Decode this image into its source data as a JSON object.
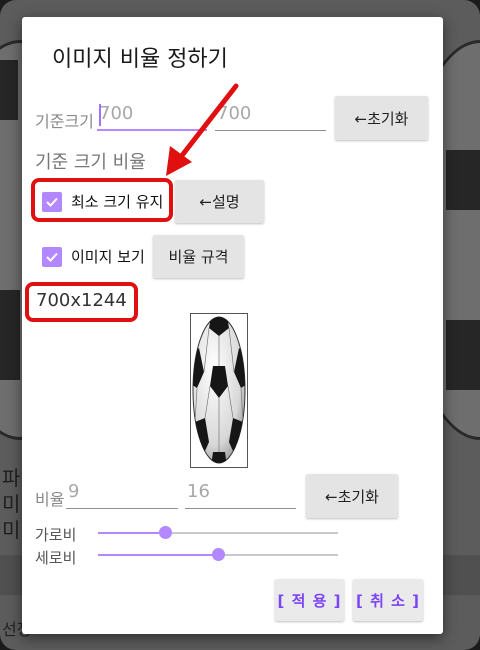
{
  "background": {
    "side_text_lines": [
      "파일",
      "미",
      "미"
    ],
    "bottom_text": "선정"
  },
  "dialog": {
    "title": "이미지 비율 정하기",
    "base_size": {
      "label": "기준크기",
      "width_value": "700",
      "height_value": "700",
      "reset_label": "←초기화"
    },
    "ratio_section_label": "기준 크기 비율",
    "keep_min_size": {
      "label": "최소 크기 유지",
      "checked": true,
      "help_label": "←설명"
    },
    "show_image": {
      "label": "이미지 보기",
      "checked": true,
      "standard_label": "비율 규격"
    },
    "result_size": "700x1244",
    "ratio": {
      "label": "비율",
      "width_value": "9",
      "height_value": "16",
      "reset_label": "←초기화"
    },
    "sliders": [
      {
        "label": "가로비",
        "value": 0.28
      },
      {
        "label": "세로비",
        "value": 0.5
      }
    ],
    "apply_label": "[ 적 용 ]",
    "cancel_label": "[ 취 소 ]"
  },
  "colors": {
    "accent": "#b388ff",
    "action_text": "#7b45f5",
    "highlight": "#e01010"
  }
}
